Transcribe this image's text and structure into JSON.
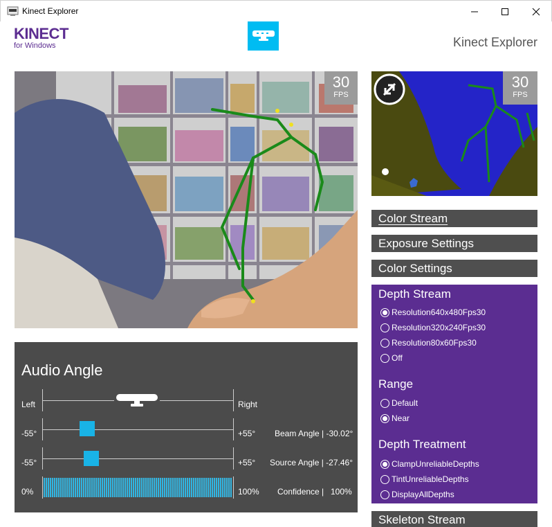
{
  "window": {
    "title": "Kinect Explorer"
  },
  "header": {
    "brand_main": "KINECT",
    "brand_sub": "for Windows",
    "app_title": "Kinect Explorer"
  },
  "color_view": {
    "fps_value": "30",
    "fps_unit": "FPS"
  },
  "depth_view": {
    "fps_value": "30",
    "fps_unit": "FPS"
  },
  "audio": {
    "title": "Audio Angle",
    "left_label": "Left",
    "right_label": "Right",
    "beam": {
      "min": "-55°",
      "max": "+55°",
      "label": "Beam Angle | -30.02°",
      "value": -30.02
    },
    "source": {
      "min": "-55°",
      "max": "+55°",
      "label": "Source Angle | -27.46°",
      "value": -27.46
    },
    "confidence": {
      "min": "0%",
      "max": "100%",
      "label": "Confidence |",
      "value_text": "100%",
      "value": 1.0
    }
  },
  "panels": {
    "color_stream": "Color Stream",
    "exposure_settings": "Exposure Settings",
    "color_settings": "Color Settings",
    "skeleton_stream": "Skeleton Stream"
  },
  "depth_stream": {
    "title": "Depth Stream",
    "resolutions": [
      {
        "label": "Resolution640x480Fps30",
        "selected": true
      },
      {
        "label": "Resolution320x240Fps30",
        "selected": false
      },
      {
        "label": "Resolution80x60Fps30",
        "selected": false
      },
      {
        "label": "Off",
        "selected": false
      }
    ],
    "range_title": "Range",
    "range": [
      {
        "label": "Default",
        "selected": false
      },
      {
        "label": "Near",
        "selected": true
      }
    ],
    "treatment_title": "Depth Treatment",
    "treatment": [
      {
        "label": "ClampUnreliableDepths",
        "selected": true
      },
      {
        "label": "TintUnreliableDepths",
        "selected": false
      },
      {
        "label": "DisplayAllDepths",
        "selected": false
      }
    ]
  },
  "colors": {
    "accent_cyan": "#00bcf2",
    "kinect_purple": "#5c2d91",
    "panel_gray": "#4f4f4f",
    "skeleton_green": "#1a8a1a"
  }
}
